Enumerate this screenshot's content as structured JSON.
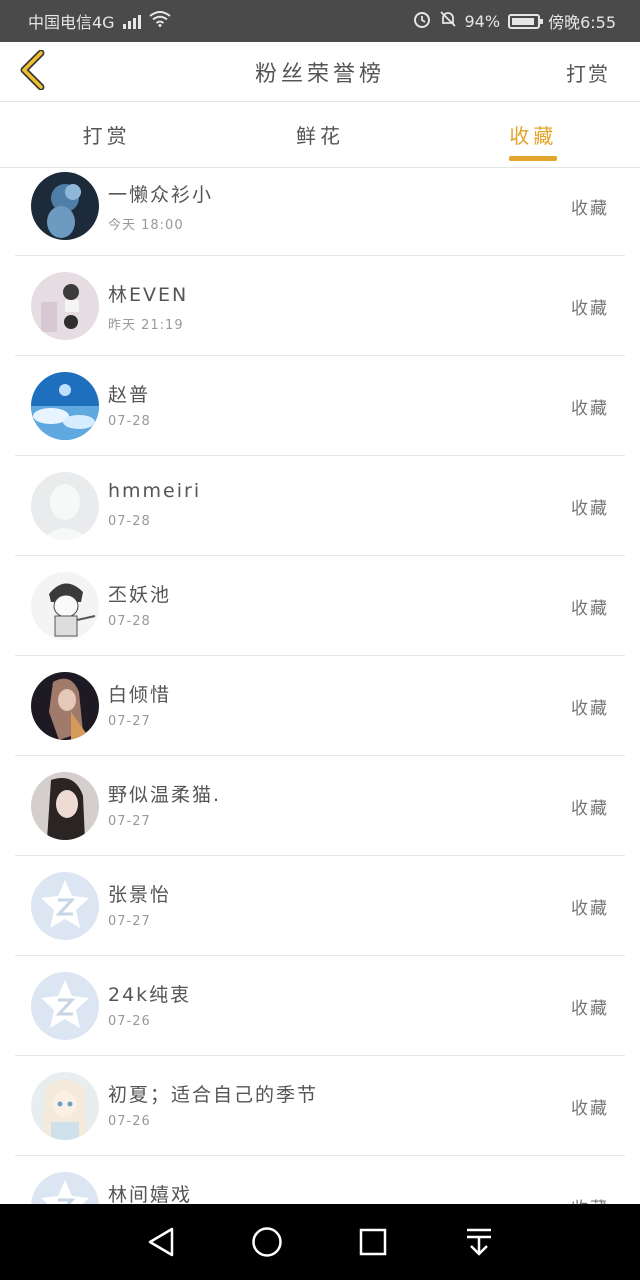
{
  "status": {
    "carrier": "中国电信4G",
    "network": "4G",
    "battery": "94%",
    "time": "傍晚6:55"
  },
  "header": {
    "back_icon": "chevron-left-icon",
    "title": "粉丝荣誉榜",
    "action": "打赏"
  },
  "tabs": [
    {
      "label": "打赏",
      "active": false
    },
    {
      "label": "鲜花",
      "active": false
    },
    {
      "label": "收藏",
      "active": true
    }
  ],
  "colors": {
    "accent": "#e3a42b",
    "status_bar": "#4a4a4a",
    "nav_bar": "#000000"
  },
  "fans": [
    {
      "name": "一懒众衫小",
      "time": "今天 18:00",
      "action": "收藏",
      "avatar": "dark-figure-avatar"
    },
    {
      "name": "林EVEN",
      "time": "昨天 21:19",
      "action": "收藏",
      "avatar": "couple-photo-avatar"
    },
    {
      "name": "赵普",
      "time": "07-28",
      "action": "收藏",
      "avatar": "blue-sky-avatar"
    },
    {
      "name": "hmmeiri",
      "time": "07-28",
      "action": "收藏",
      "avatar": "default-silhouette-avatar"
    },
    {
      "name": "丕妖池",
      "time": "07-28",
      "action": "收藏",
      "avatar": "sketch-boy-avatar"
    },
    {
      "name": "白倾惜",
      "time": "07-27",
      "action": "收藏",
      "avatar": "dark-portrait-avatar"
    },
    {
      "name": "野似温柔猫.",
      "time": "07-27",
      "action": "收藏",
      "avatar": "girl-portrait-avatar"
    },
    {
      "name": "张景怡",
      "time": "07-27",
      "action": "收藏",
      "avatar": "qzone-star-avatar"
    },
    {
      "name": "24k纯衷",
      "time": "07-26",
      "action": "收藏",
      "avatar": "qzone-star-avatar"
    },
    {
      "name": "初夏；适合自己的季节",
      "time": "07-26",
      "action": "收藏",
      "avatar": "anime-girl-avatar"
    },
    {
      "name": "林间嬉戏",
      "time": "",
      "action": "收藏",
      "avatar": "qzone-star-avatar"
    }
  ],
  "navbar": [
    "back-triangle-icon",
    "home-circle-icon",
    "recents-square-icon",
    "notification-pull-icon"
  ]
}
